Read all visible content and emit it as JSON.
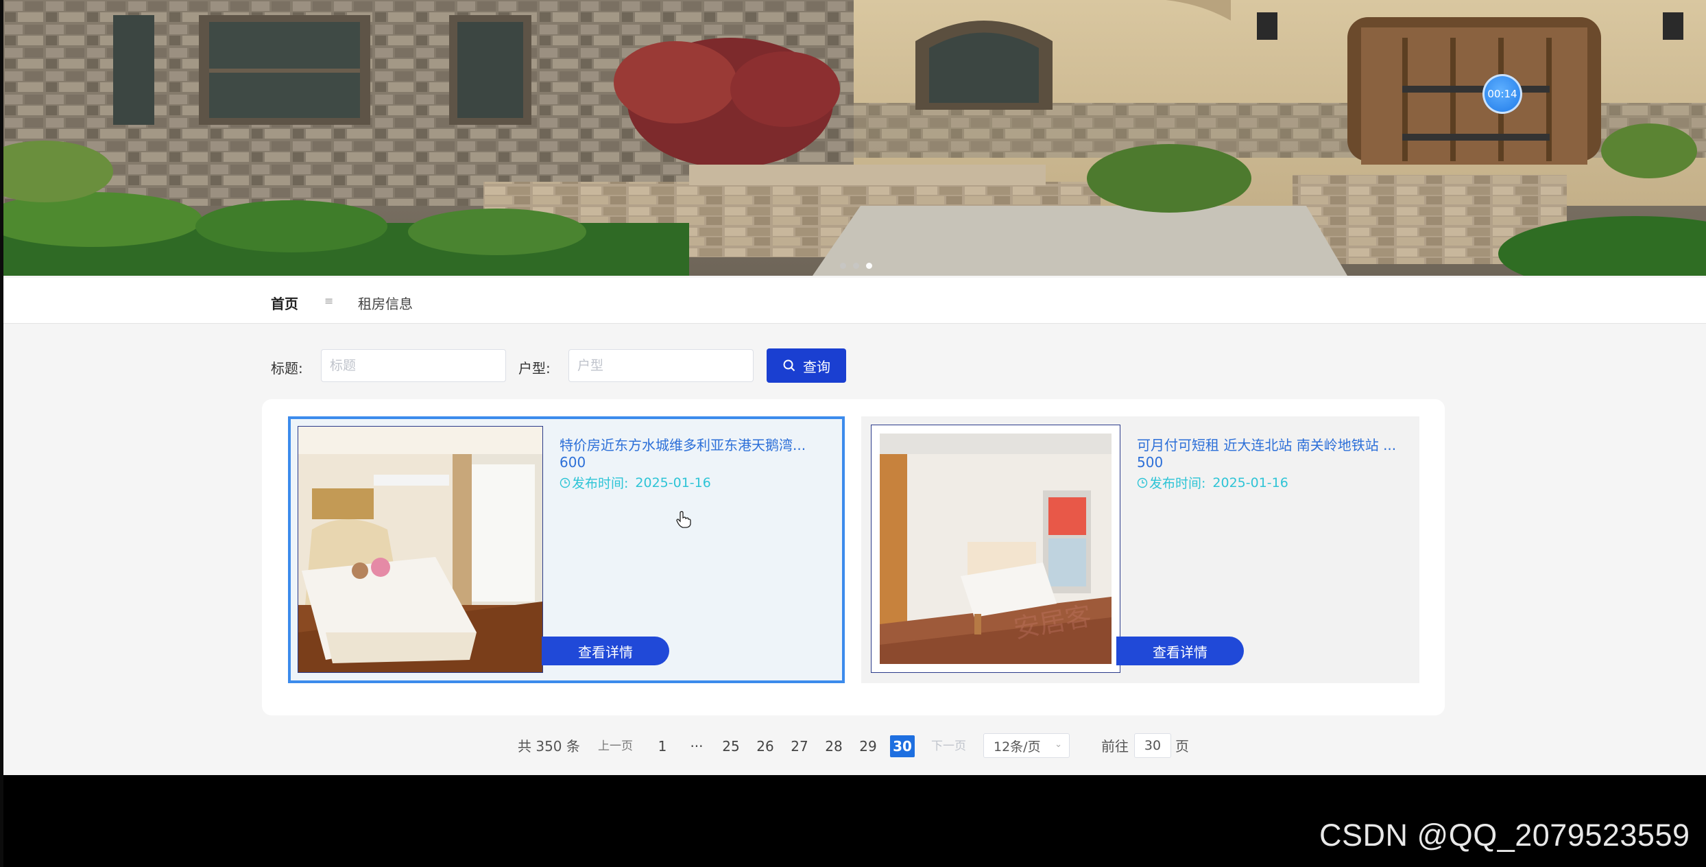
{
  "banner": {
    "timer_text": "00:14",
    "carousel_dots": 3,
    "active_dot": 3
  },
  "breadcrumb": {
    "home": "首页",
    "separator": "≡",
    "current": "租房信息"
  },
  "search": {
    "title_label": "标题:",
    "title_placeholder": "标题",
    "type_label": "户型:",
    "type_placeholder": "户型",
    "query_button": "查询"
  },
  "listings": [
    {
      "title": "特价房近东方水城维多利亚东港天鹅湾...",
      "price": "600",
      "time_label": "发布时间:",
      "date": "2025-01-16",
      "detail_button": "查看详情"
    },
    {
      "title": "可月付可短租 近大连北站 南关岭地铁站 ...",
      "price": "500",
      "time_label": "发布时间:",
      "date": "2025-01-16",
      "detail_button": "查看详情"
    }
  ],
  "pagination": {
    "total": "共 350 条",
    "prev": "上一页",
    "pages": [
      "1",
      "···",
      "25",
      "26",
      "27",
      "28",
      "29",
      "30"
    ],
    "current": "30",
    "next": "下一页",
    "page_size": "12条/页",
    "goto_label": "前往",
    "goto_value": "30",
    "page_suffix": "页"
  },
  "watermark": "CSDN @QQ_2079523559",
  "colors": {
    "primary": "#1a3fd1",
    "accent_blue": "#2c6fd8",
    "cyan_time": "#2ec4d6",
    "selected_border": "#3c8bec",
    "active_page": "#1e6fe0"
  }
}
